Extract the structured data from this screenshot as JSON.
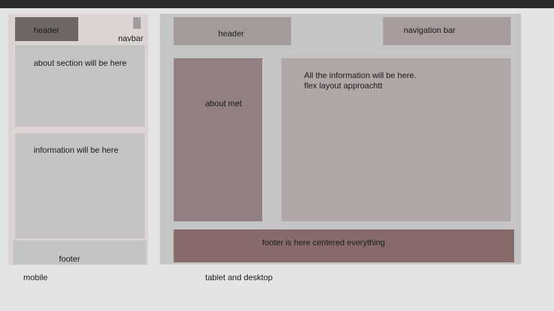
{
  "mobile": {
    "header": "header",
    "navbar": "navbar",
    "about": "about section will be here",
    "info": "information will be here",
    "footer": "footer",
    "caption": "mobile"
  },
  "desktop": {
    "header": "header",
    "navbar": "navigation bar",
    "about": "about met",
    "info_line1": "All the information will be here.",
    "info_line2": "flex layout approachtt",
    "footer": "footer is here centered everything",
    "caption": "tablet and desktop"
  },
  "colors": {
    "page_background": "#e4e4e4",
    "mobile_frame": "#dcd3d3",
    "mobile_header": "#716666",
    "desktop_frame": "#c5c5c5",
    "desktop_about": "#928080",
    "desktop_info": "#b1a7a7",
    "desktop_footer": "#876b6b"
  }
}
